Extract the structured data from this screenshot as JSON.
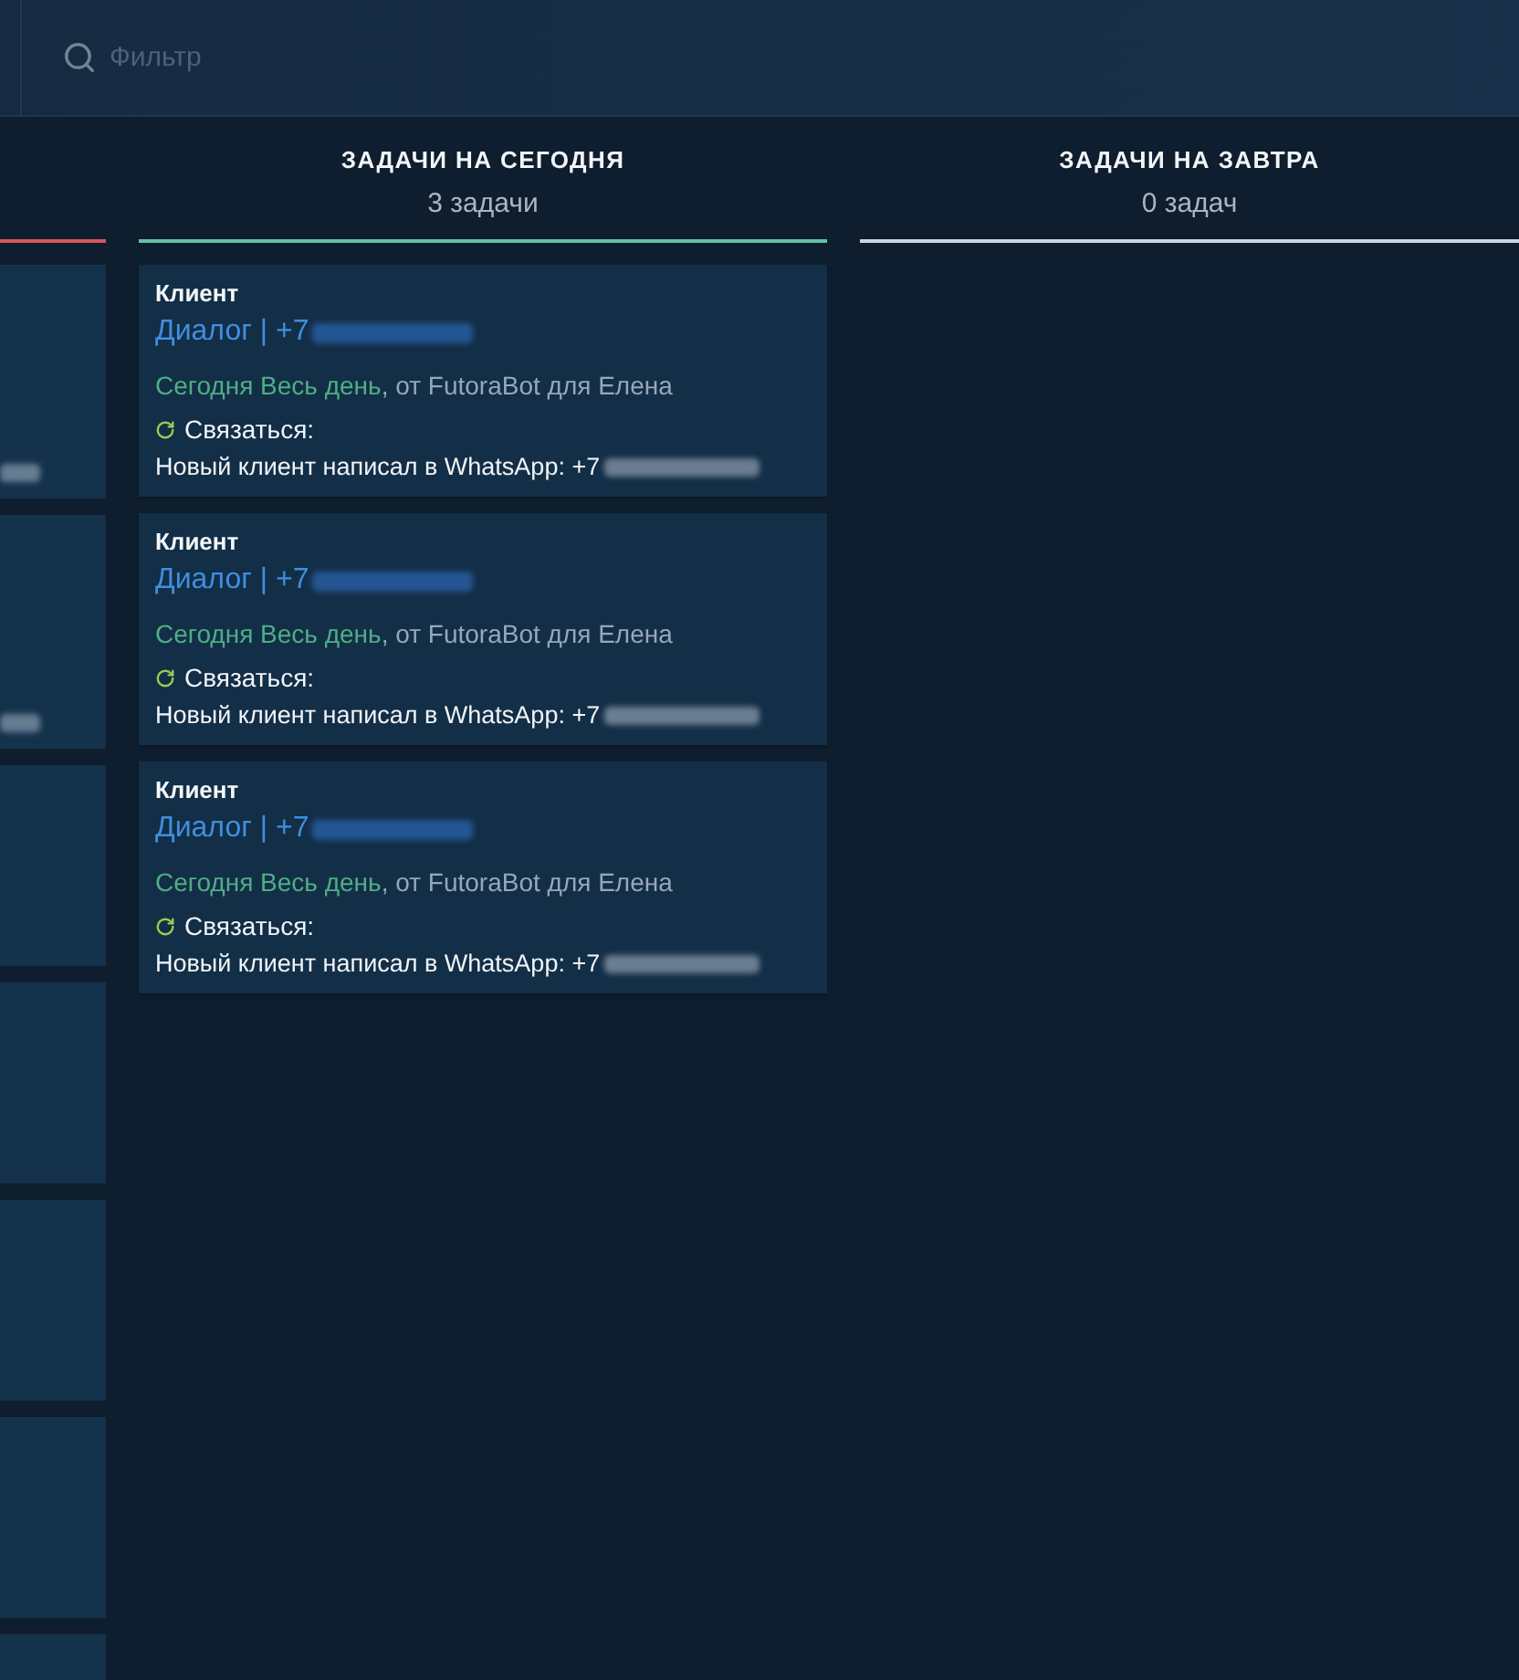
{
  "filter": {
    "placeholder": "Фильтр"
  },
  "columns": [
    {
      "color": "#d95556",
      "cards": [
        {
          "redacted": true
        },
        {
          "redacted": true
        },
        {
          "redacted": false
        },
        {
          "redacted": false
        },
        {
          "redacted": false
        },
        {
          "redacted": false
        },
        {
          "redacted": false
        }
      ]
    },
    {
      "title": "ЗАДАЧИ НА СЕГОДНЯ",
      "count": "3 задачи",
      "color": "#63c2a4",
      "cards": [
        {
          "client": "Клиент",
          "link": "Диалог | +7",
          "when": "Сегодня Весь день",
          "meta": ", от FutoraBot для Елена",
          "action": "Связаться:",
          "message": "Новый клиент написал в WhatsApp: +7"
        },
        {
          "client": "Клиент",
          "link": "Диалог | +7",
          "when": "Сегодня Весь день",
          "meta": ", от FutoraBot для Елена",
          "action": "Связаться:",
          "message": "Новый клиент написал в WhatsApp: +7"
        },
        {
          "client": "Клиент",
          "link": "Диалог | +7",
          "when": "Сегодня Весь день",
          "meta": ", от FutoraBot для Елена",
          "action": "Связаться:",
          "message": "Новый клиент написал в WhatsApp: +7"
        }
      ]
    },
    {
      "title": "ЗАДАЧИ НА ЗАВТРА",
      "count": "0 задач",
      "color": "#c9d6e0"
    }
  ]
}
